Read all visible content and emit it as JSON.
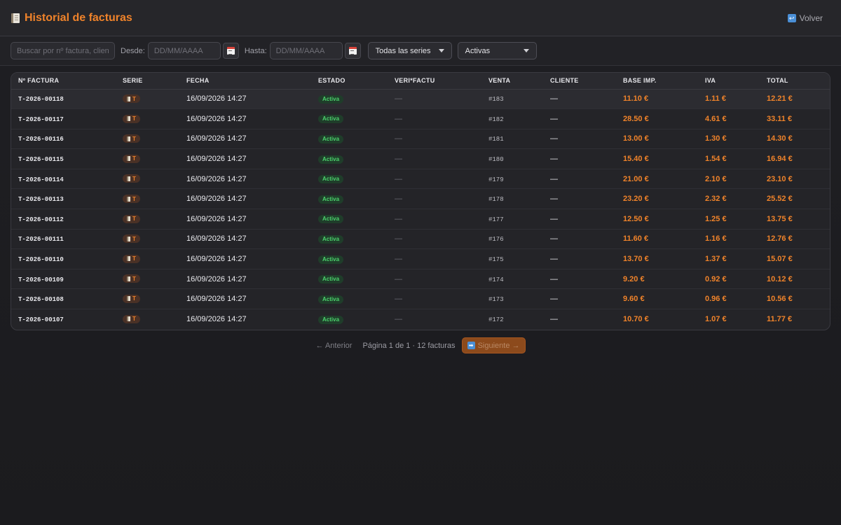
{
  "header": {
    "title": "Historial de facturas",
    "back_label": "Volver",
    "title_icon": "receipt-icon",
    "back_icon": "back-arrow-icon"
  },
  "filters": {
    "search_placeholder": "Buscar por nº factura, cliente,",
    "desde_label": "Desde:",
    "desde_placeholder": "DD/MM/AAAA",
    "hasta_label": "Hasta:",
    "hasta_placeholder": "DD/MM/AAAA",
    "series_selected": "Todas las series",
    "estado_selected": "Activas"
  },
  "table": {
    "columns": [
      "Nº FACTURA",
      "SERIE",
      "FECHA",
      "ESTADO",
      "VERI*FACTU",
      "VENTA",
      "CLIENTE",
      "BASE IMP.",
      "IVA",
      "TOTAL"
    ],
    "rows": [
      {
        "numero": "T-2026-00118",
        "serie": "T",
        "fecha": "16/09/2026 14:27",
        "estado": "Activa",
        "verifactu": "—",
        "venta": "#183",
        "cliente": "—",
        "base": "11.10 €",
        "iva": "1.11 €",
        "total": "12.21 €"
      },
      {
        "numero": "T-2026-00117",
        "serie": "T",
        "fecha": "16/09/2026 14:27",
        "estado": "Activa",
        "verifactu": "—",
        "venta": "#182",
        "cliente": "—",
        "base": "28.50 €",
        "iva": "4.61 €",
        "total": "33.11 €"
      },
      {
        "numero": "T-2026-00116",
        "serie": "T",
        "fecha": "16/09/2026 14:27",
        "estado": "Activa",
        "verifactu": "—",
        "venta": "#181",
        "cliente": "—",
        "base": "13.00 €",
        "iva": "1.30 €",
        "total": "14.30 €"
      },
      {
        "numero": "T-2026-00115",
        "serie": "T",
        "fecha": "16/09/2026 14:27",
        "estado": "Activa",
        "verifactu": "—",
        "venta": "#180",
        "cliente": "—",
        "base": "15.40 €",
        "iva": "1.54 €",
        "total": "16.94 €"
      },
      {
        "numero": "T-2026-00114",
        "serie": "T",
        "fecha": "16/09/2026 14:27",
        "estado": "Activa",
        "verifactu": "—",
        "venta": "#179",
        "cliente": "—",
        "base": "21.00 €",
        "iva": "2.10 €",
        "total": "23.10 €"
      },
      {
        "numero": "T-2026-00113",
        "serie": "T",
        "fecha": "16/09/2026 14:27",
        "estado": "Activa",
        "verifactu": "—",
        "venta": "#178",
        "cliente": "—",
        "base": "23.20 €",
        "iva": "2.32 €",
        "total": "25.52 €"
      },
      {
        "numero": "T-2026-00112",
        "serie": "T",
        "fecha": "16/09/2026 14:27",
        "estado": "Activa",
        "verifactu": "—",
        "venta": "#177",
        "cliente": "—",
        "base": "12.50 €",
        "iva": "1.25 €",
        "total": "13.75 €"
      },
      {
        "numero": "T-2026-00111",
        "serie": "T",
        "fecha": "16/09/2026 14:27",
        "estado": "Activa",
        "verifactu": "—",
        "venta": "#176",
        "cliente": "—",
        "base": "11.60 €",
        "iva": "1.16 €",
        "total": "12.76 €"
      },
      {
        "numero": "T-2026-00110",
        "serie": "T",
        "fecha": "16/09/2026 14:27",
        "estado": "Activa",
        "verifactu": "—",
        "venta": "#175",
        "cliente": "—",
        "base": "13.70 €",
        "iva": "1.37 €",
        "total": "15.07 €"
      },
      {
        "numero": "T-2026-00109",
        "serie": "T",
        "fecha": "16/09/2026 14:27",
        "estado": "Activa",
        "verifactu": "—",
        "venta": "#174",
        "cliente": "—",
        "base": "9.20 €",
        "iva": "0.92 €",
        "total": "10.12 €"
      },
      {
        "numero": "T-2026-00108",
        "serie": "T",
        "fecha": "16/09/2026 14:27",
        "estado": "Activa",
        "verifactu": "—",
        "venta": "#173",
        "cliente": "—",
        "base": "9.60 €",
        "iva": "0.96 €",
        "total": "10.56 €"
      },
      {
        "numero": "T-2026-00107",
        "serie": "T",
        "fecha": "16/09/2026 14:27",
        "estado": "Activa",
        "verifactu": "—",
        "venta": "#172",
        "cliente": "—",
        "base": "10.70 €",
        "iva": "1.07 €",
        "total": "11.77 €"
      }
    ]
  },
  "pagination": {
    "prev_label": "← Anterior",
    "info": "Página 1 de 1 · 12 facturas",
    "next_label": "Siguiente →"
  },
  "colors": {
    "accent": "#f0832a",
    "status_active": "#4cd26c",
    "background": "#1d1d21"
  }
}
